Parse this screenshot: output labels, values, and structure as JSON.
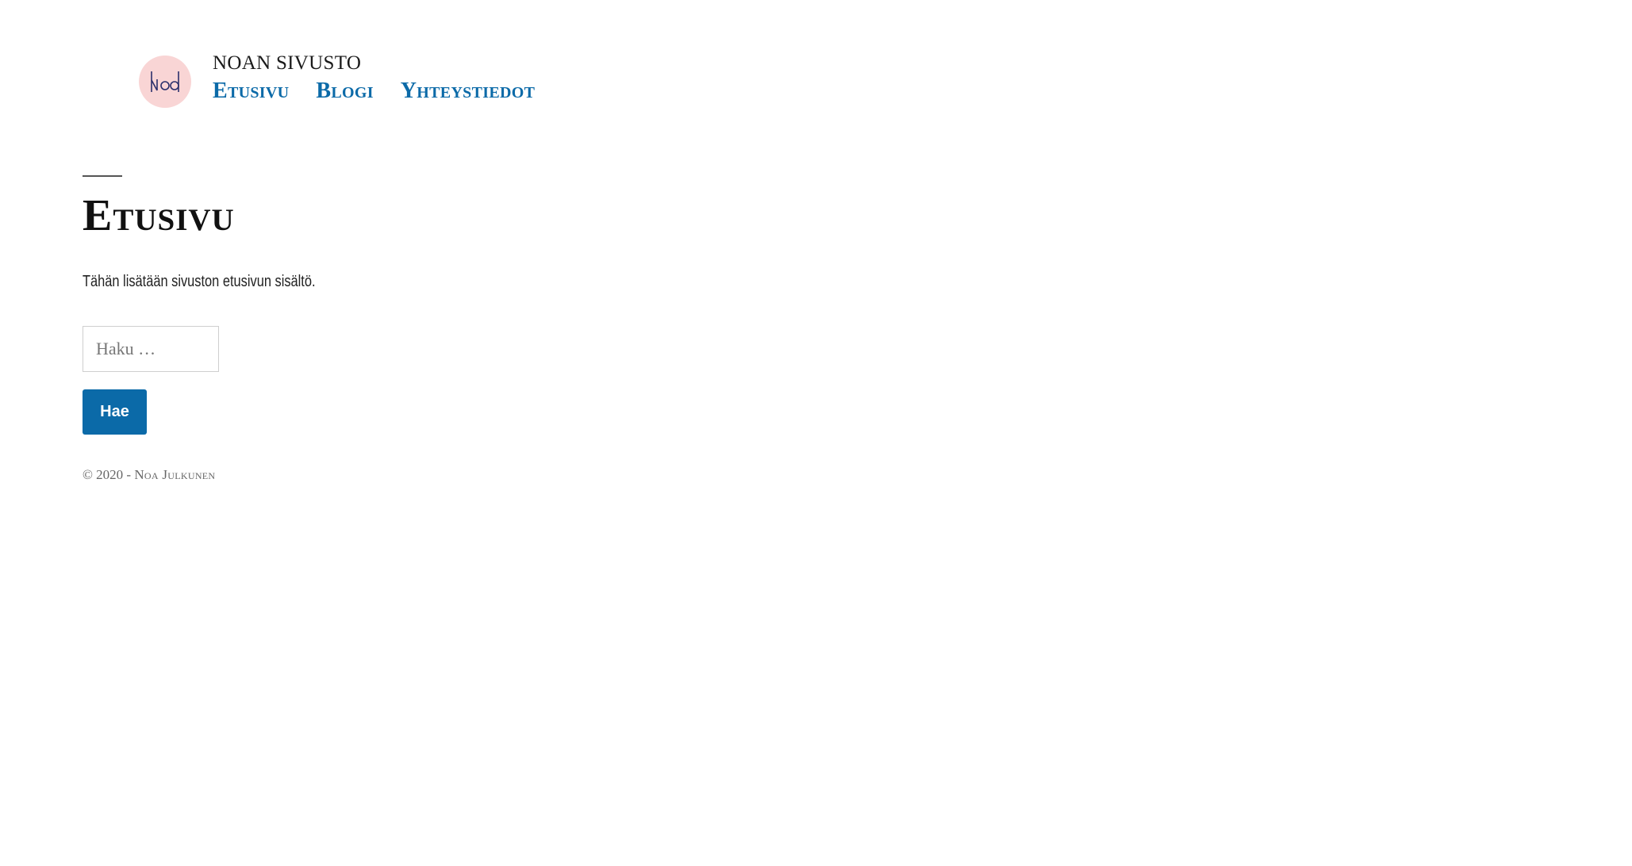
{
  "header": {
    "logo_text": "Noa",
    "site_title": "NOAN SIVUSTO",
    "nav": [
      {
        "label": "Etusivu"
      },
      {
        "label": "Blogi"
      },
      {
        "label": "Yhteystiedot"
      }
    ]
  },
  "main": {
    "title": "Etusivu",
    "intro": "Tähän lisätään sivuston etusivun sisältö.",
    "search": {
      "placeholder": "Haku …",
      "value": "",
      "button_label": "Hae"
    }
  },
  "footer": {
    "copyright": "© 2020 -",
    "author": "Noa Julkunen"
  },
  "colors": {
    "accent": "#0b6aa8",
    "logo_background": "#f9d5d5",
    "logo_ink": "#2a2f6b",
    "text": "#111111",
    "muted": "#666666"
  }
}
